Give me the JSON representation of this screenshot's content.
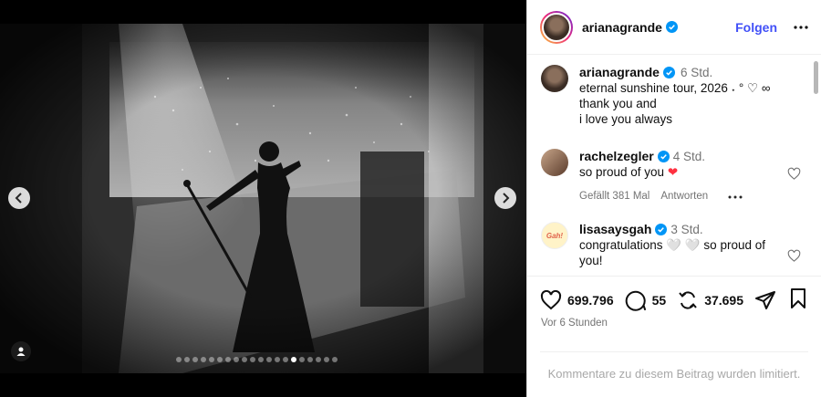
{
  "media": {
    "carousel": {
      "total_slides": 20,
      "active_slide": 15
    }
  },
  "header": {
    "username": "arianagrande",
    "follow_label": "Folgen"
  },
  "caption": {
    "username": "arianagrande",
    "time": "6 Std.",
    "lines": [
      "eternal sunshine tour, 2026 ˖ ° ♡ ∞",
      "thank you and",
      "i love you always"
    ]
  },
  "comments": [
    {
      "username": "rachelzegler",
      "time": "4 Std.",
      "text": "so proud of you ❤",
      "likes_label": "Gefällt 381 Mal",
      "reply_label": "Antworten"
    },
    {
      "username": "lisasaysgah",
      "time": "3 Std.",
      "text": "congratulations 🤍 🤍 so proud of you!",
      "avatar_text": "Gah!"
    }
  ],
  "actions": {
    "likes": "699.796",
    "comments": "55",
    "reposts": "37.695"
  },
  "timestamp": "Vor 6 Stunden",
  "comments_limited": "Kommentare zu diesem Beitrag wurden limitiert.",
  "colors": {
    "accent": "#4150f7",
    "verified": "#0095f6",
    "heart": "#ff3040"
  }
}
